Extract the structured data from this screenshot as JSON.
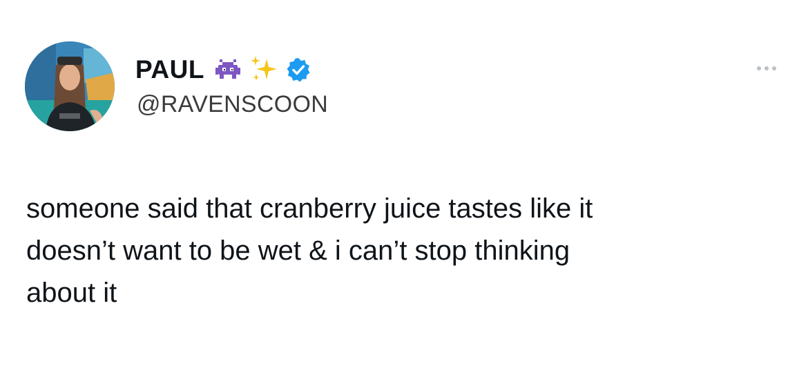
{
  "tweet": {
    "author": {
      "display_name": "PAUL",
      "handle": "@RAVENSCOON",
      "verified": true,
      "name_emojis": [
        "alien-monster-icon",
        "sparkles-icon"
      ],
      "avatar": "profile-photo"
    },
    "text": "someone said that cranberry juice tastes like it\ndoesn’t want to be wet & i can’t stop thinking\nabout it",
    "more_menu_icon": "ellipsis-icon"
  },
  "colors": {
    "background": "#ffffff",
    "text": "#0f1419",
    "handle": "#3b3b3b",
    "verified_badge": "#1d9bf0",
    "alien_monster": "#7e57c2",
    "sparkles": "#f5c518",
    "more_dots": "#b9c0c6"
  }
}
